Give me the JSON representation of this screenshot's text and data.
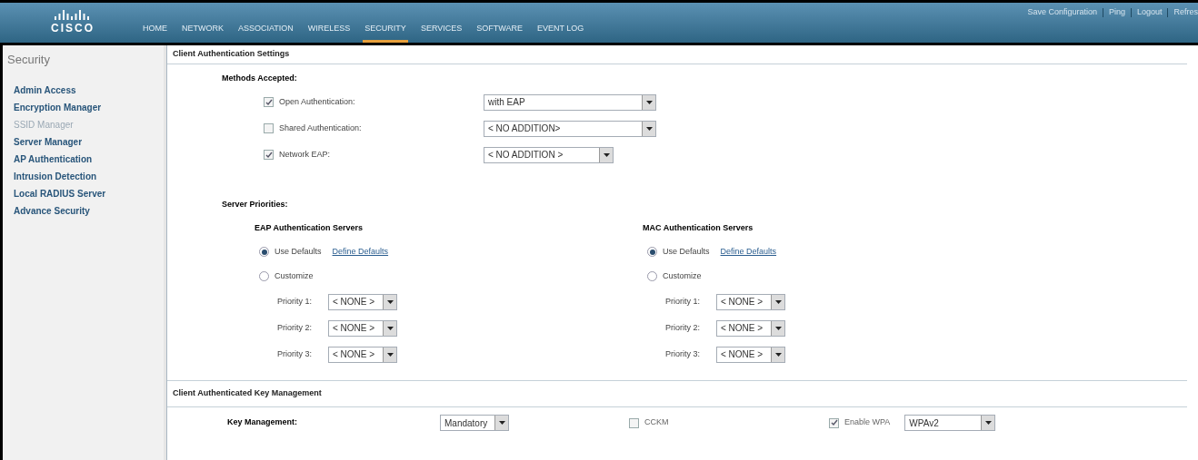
{
  "header": {
    "logo": {
      "wordmark": "CISCO"
    },
    "nav": [
      {
        "label": "HOME",
        "selected": false
      },
      {
        "label": "NETWORK",
        "selected": false
      },
      {
        "label": "ASSOCIATION",
        "selected": false
      },
      {
        "label": "WIRELESS",
        "selected": false
      },
      {
        "label": "SECURITY",
        "selected": true
      },
      {
        "label": "SERVICES",
        "selected": false
      },
      {
        "label": "SOFTWARE",
        "selected": false
      },
      {
        "label": "EVENT LOG",
        "selected": false
      }
    ],
    "links": [
      "Save Configuration",
      "Ping",
      "Logout",
      "Refres"
    ]
  },
  "sidebar": {
    "title": "Security",
    "items": [
      {
        "label": "Admin Access",
        "disabled": false
      },
      {
        "label": "Encryption Manager",
        "disabled": false
      },
      {
        "label": "SSID Manager",
        "disabled": true
      },
      {
        "label": "Server Manager",
        "disabled": false
      },
      {
        "label": "AP Authentication",
        "disabled": false
      },
      {
        "label": "Intrusion Detection",
        "disabled": false
      },
      {
        "label": "Local RADIUS Server",
        "disabled": false
      },
      {
        "label": "Advance Security",
        "disabled": false
      }
    ]
  },
  "client_auth": {
    "title": "Client Authentication Settings",
    "methods_label": "Methods Accepted:",
    "methods": [
      {
        "label": "Open Authentication:",
        "checked": true,
        "value": "with EAP"
      },
      {
        "label": "Shared Authentication:",
        "checked": false,
        "value": "< NO ADDITION>"
      },
      {
        "label": "Network EAP:",
        "checked": true,
        "value": "< NO ADDITION >"
      }
    ],
    "server_priorities_label": "Server Priorities:",
    "server_groups": [
      {
        "title": "EAP Authentication Servers",
        "options": [
          {
            "label": "Use Defaults",
            "selected": true,
            "link": "Define Defaults"
          },
          {
            "label": "Customize",
            "selected": false
          }
        ],
        "priorities": [
          {
            "label": "Priority 1:",
            "value": "< NONE >"
          },
          {
            "label": "Priority 2:",
            "value": "< NONE >"
          },
          {
            "label": "Priority 3:",
            "value": "< NONE >"
          }
        ]
      },
      {
        "title": "MAC Authentication Servers",
        "options": [
          {
            "label": "Use Defaults",
            "selected": true,
            "link": "Define Defaults"
          },
          {
            "label": "Customize",
            "selected": false
          }
        ],
        "priorities": [
          {
            "label": "Priority 1:",
            "value": "< NONE >"
          },
          {
            "label": "Priority 2:",
            "value": "< NONE >"
          },
          {
            "label": "Priority 3:",
            "value": "< NONE >"
          }
        ]
      }
    ]
  },
  "key_management": {
    "title": "Client Authenticated Key Management",
    "label": "Key Management:",
    "mode": "Mandatory",
    "cckm": {
      "label": "CCKM",
      "checked": false
    },
    "wpa": {
      "label": "Enable WPA",
      "checked": true,
      "value": "WPAv2"
    }
  }
}
